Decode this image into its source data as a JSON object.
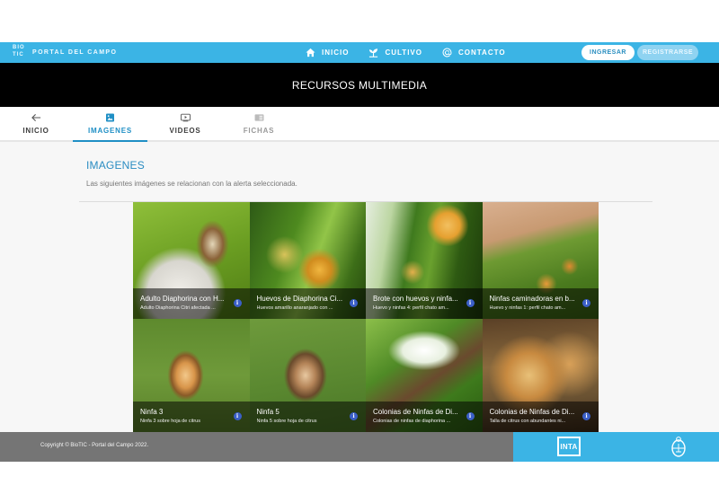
{
  "brand": {
    "mark": "BIO TIC",
    "name": "PORTAL DEL CAMPO"
  },
  "nav": [
    {
      "label": "INICIO",
      "icon": "home-icon"
    },
    {
      "label": "CULTIVO",
      "icon": "plant-icon"
    },
    {
      "label": "CONTACTO",
      "icon": "at-icon"
    }
  ],
  "auth": {
    "login": "INGRESAR",
    "register": "REGISTRARSE"
  },
  "page_title": "RECURSOS MULTIMEDIA",
  "tabs": [
    {
      "label": "INICIO",
      "icon": "arrow-left-icon",
      "state": "normal"
    },
    {
      "label": "IMAGENES",
      "icon": "image-icon",
      "state": "active"
    },
    {
      "label": "VIDEOS",
      "icon": "video-icon",
      "state": "normal"
    },
    {
      "label": "FICHAS",
      "icon": "document-icon",
      "state": "disabled"
    }
  ],
  "section": {
    "title": "IMAGENES",
    "subtitle": "Las siguientes imágenes se relacionan con la alerta seleccionada."
  },
  "images": [
    {
      "title": "Adulto Diaphorina con H...",
      "caption": "Adulto Diaphorina Citri afectada ..."
    },
    {
      "title": "Huevos de Diaphorina Ci...",
      "caption": "Huevos amarillo anaranjado con ..."
    },
    {
      "title": "Brote con huevos y ninfa...",
      "caption": "Huevo y ninfas 4: perfil chato am..."
    },
    {
      "title": "Ninfas caminadoras en b...",
      "caption": "Huevo y ninfas 1: perfil chato am..."
    },
    {
      "title": "Ninfa 3",
      "caption": "Ninfa 3 sobre hoja de citrus"
    },
    {
      "title": "Ninfa 5",
      "caption": "Ninfa 5 sobre hoja de citrus"
    },
    {
      "title": "Colonias de Ninfas de Di...",
      "caption": "Colonias de ninfas de diaphorina ..."
    },
    {
      "title": "Colonias de Ninfas de Di...",
      "caption": "Talla de citrus con abundantes ni..."
    }
  ],
  "info_glyph": "i",
  "footer": {
    "copyright": "Copyright © BioTIC - Portal del Campo 2022.",
    "partner_logo": "INTA"
  },
  "colors": {
    "accent": "#3bb4e5",
    "title_band": "#000000",
    "footer": "#757575",
    "active_tab": "#1f8fc5"
  }
}
